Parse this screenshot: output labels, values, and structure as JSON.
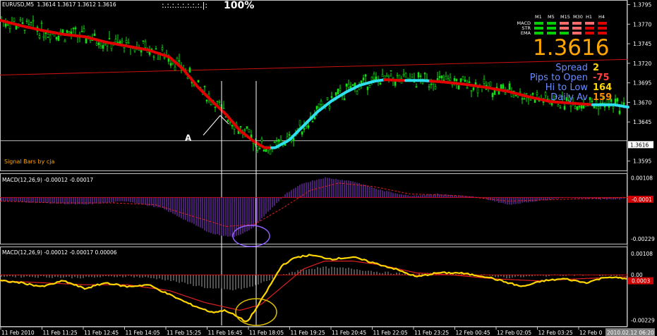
{
  "header": {
    "symbol": "EURUSD,M5",
    "ohlc": "1.3614 1.3617 1.3612 1.3616",
    "zoom_dots": ":.:.:.:.:.:.:.:.|:",
    "zoom_pct": "100%"
  },
  "signal_label": "Signal Bars by cja",
  "annotation_a": "A",
  "dashboard": {
    "timeframes": [
      "M1",
      "M5",
      "M15",
      "M30",
      "H1",
      "H4"
    ],
    "rows": [
      {
        "label": "MACD",
        "colors": [
          "#00d000",
          "#00d000",
          "#ff6a6a",
          "#ff6a6a",
          "#ff6a6a",
          "#e00000"
        ]
      },
      {
        "label": "STR",
        "colors": [
          "#00d000",
          "#00d000",
          "#ff6a6a",
          "#ff6a6a",
          "#e00000",
          "#e00000"
        ]
      },
      {
        "label": "EMA",
        "colors": [
          "#00d000",
          "#00d000",
          "#00d000",
          "#ff6a6a",
          "#e00000",
          "#e00000"
        ]
      }
    ],
    "price": "1.3616",
    "price_color": "#ffa500",
    "info": [
      {
        "label": "Spread",
        "value": "2",
        "color": "#ffd700"
      },
      {
        "label": "Pips to Open",
        "value": "-75",
        "color": "#ff4040"
      },
      {
        "label": "Hi to Low",
        "value": "164",
        "color": "#ffd700"
      },
      {
        "label": "Daily Av",
        "value": "159",
        "color": "#ff8c00"
      }
    ]
  },
  "chart_data": [
    {
      "type": "candlestick",
      "panel": "price",
      "y_axis_ticks": [
        "1.3795",
        "1.3770",
        "1.3745",
        "1.3720",
        "1.3695",
        "1.3670",
        "1.3645",
        "1.3595"
      ],
      "current_price_tag": "1.3616",
      "ylim": [
        1.3583,
        1.38
      ],
      "ema_series": [
        [
          0,
          1.3775
        ],
        [
          30,
          1.3768
        ],
        [
          60,
          1.3762
        ],
        [
          90,
          1.3757
        ],
        [
          120,
          1.3754
        ],
        [
          150,
          1.3747
        ],
        [
          180,
          1.3742
        ],
        [
          210,
          1.3737
        ],
        [
          240,
          1.3728
        ],
        [
          260,
          1.3712
        ],
        [
          280,
          1.369
        ],
        [
          300,
          1.3672
        ],
        [
          320,
          1.3655
        ],
        [
          340,
          1.3634
        ],
        [
          360,
          1.362
        ],
        [
          375,
          1.3612
        ],
        [
          390,
          1.3612
        ],
        [
          410,
          1.3622
        ],
        [
          430,
          1.364
        ],
        [
          450,
          1.3658
        ],
        [
          470,
          1.3672
        ],
        [
          490,
          1.3683
        ],
        [
          510,
          1.3692
        ],
        [
          530,
          1.3697
        ],
        [
          545,
          1.3699
        ],
        [
          570,
          1.3698
        ],
        [
          600,
          1.3698
        ],
        [
          630,
          1.3696
        ],
        [
          660,
          1.3693
        ],
        [
          690,
          1.3689
        ],
        [
          720,
          1.3684
        ],
        [
          750,
          1.3677
        ],
        [
          780,
          1.3671
        ],
        [
          810,
          1.3669
        ],
        [
          840,
          1.3667
        ],
        [
          870,
          1.3667
        ],
        [
          890,
          1.3664
        ]
      ],
      "ema_colors": [
        {
          "from": 0,
          "to": 385,
          "color": "#e00000"
        },
        {
          "from": 385,
          "to": 545,
          "color": "#30e0f0"
        },
        {
          "from": 545,
          "to": 575,
          "color": "#e00000"
        },
        {
          "from": 575,
          "to": 610,
          "color": "#30e0f0"
        },
        {
          "from": 610,
          "to": 840,
          "color": "#e00000"
        },
        {
          "from": 840,
          "to": 890,
          "color": "#30e0f0"
        }
      ],
      "trendline": {
        "from": [
          0,
          1.3705
        ],
        "to": [
          890,
          1.3725
        ],
        "color": "#cc1010"
      },
      "hline": {
        "y": 1.3621,
        "color": "#c0c0c0"
      },
      "vlines": [
        314,
        363
      ]
    },
    {
      "type": "bar",
      "panel": "macd1",
      "title": "MACD(12,26,9) -0.00012 -0.00017",
      "y_axis_ticks": [
        "0.00108",
        "-0.00229"
      ],
      "current_value_tag": "-0.0001",
      "ylim": [
        -0.0026,
        0.0013
      ]
    },
    {
      "type": "line",
      "panel": "macd2",
      "title": "MACD(12,26,9) -0.00012 -0.00017 0.00006",
      "y_axis_ticks": [
        "0.00108",
        "0.00",
        "-0.00229"
      ],
      "current_value_tag": "0.0003",
      "ylim": [
        -0.0026,
        0.0014
      ]
    }
  ],
  "x_axis_labels": [
    "11 Feb 2010",
    "11 Feb 11:25",
    "11 Feb 12:45",
    "11 Feb 14:05",
    "11 Feb 15:25",
    "11 Feb 16:45",
    "11 Feb 18:05",
    "11 Feb 19:25",
    "11 Feb 20:45",
    "11 Feb 22:05",
    "11 Feb 23:25",
    "12 Feb 00:45",
    "12 Feb 02:05",
    "12 Feb 03:25",
    "12 Feb 0"
  ],
  "x_axis_last_tag": "2010.02.12 06:20"
}
